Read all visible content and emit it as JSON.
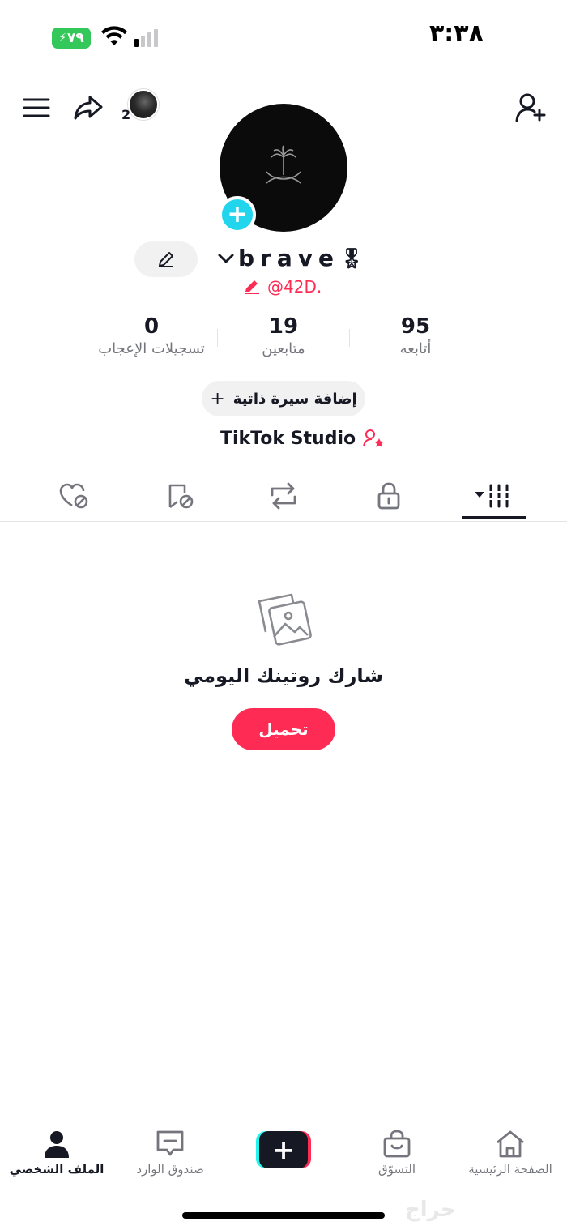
{
  "status_bar": {
    "time": "٣:٣٨",
    "battery": "٧٩"
  },
  "header": {
    "story_count": "2"
  },
  "profile": {
    "display_name": "brave",
    "username": "@42D.",
    "add_bio_label": "إضافة سيرة ذاتية",
    "studio_label": "TikTok Studio"
  },
  "stats": [
    {
      "value": "95",
      "label": "أتابعه"
    },
    {
      "value": "19",
      "label": "متابعين"
    },
    {
      "value": "0",
      "label": "تسجيلات الإعجاب"
    }
  ],
  "empty_state": {
    "title": "شارك روتينك اليومي",
    "button_label": "تحميل"
  },
  "bottom_nav": {
    "home": "الصفحة الرئيسية",
    "shop": "التسوّق",
    "inbox": "صندوق الوارد",
    "profile": "الملف الشخصي"
  },
  "colors": {
    "accent": "#fe2c55",
    "cyan": "#25f4ee",
    "text": "#161823",
    "muted": "#75767d"
  },
  "watermark": "حراج"
}
